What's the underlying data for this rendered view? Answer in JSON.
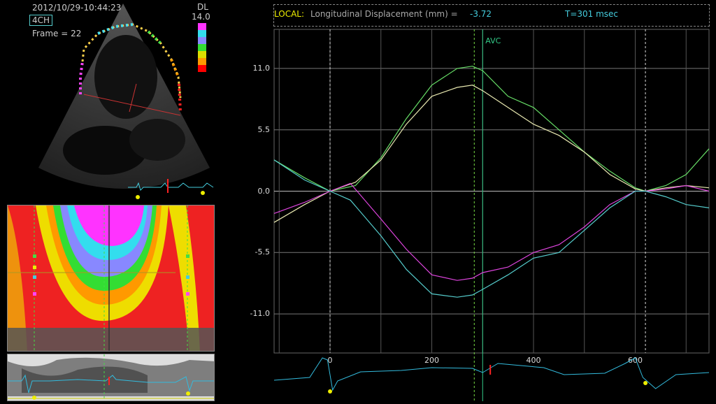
{
  "echo": {
    "timestamp": "2012/10/29-10:44:23",
    "view": "4CH",
    "frame": "Frame = 22",
    "scale_title": "DL",
    "scale_value": "14.0",
    "scale_colors": [
      "#ff33ff",
      "#33ddee",
      "#8888ff",
      "#33dd33",
      "#dddd00",
      "#ff9900",
      "#ff0000"
    ]
  },
  "header": {
    "local_label": "LOCAL:",
    "title": "Longitudinal Displacement (mm) =",
    "value": "-3.72",
    "time": "T=301 msec"
  },
  "graph": {
    "avc_label": "AVC",
    "ytick_labels": [
      "11.0",
      "5.5",
      "0.0",
      "-5.5",
      "-11.0"
    ],
    "xtick_labels": [
      "0",
      "200",
      "400",
      "600"
    ]
  },
  "chart_data": {
    "type": "line",
    "title": "Longitudinal Displacement (mm)",
    "xlabel": "msec",
    "ylabel": "",
    "xlim": [
      -110,
      745
    ],
    "ylim": [
      -14.5,
      14.5
    ],
    "yticks": [
      11.0,
      5.5,
      0.0,
      -5.5,
      -11.0
    ],
    "xticks": [
      0,
      200,
      400,
      600
    ],
    "vertical_markers": [
      {
        "label": "AVC",
        "x": 300
      },
      {
        "label": "",
        "x": 0
      },
      {
        "label": "",
        "x": 620
      }
    ],
    "series": [
      {
        "color": "#66dd66",
        "x": [
          -110,
          -50,
          0,
          50,
          100,
          150,
          200,
          250,
          280,
          300,
          350,
          400,
          450,
          500,
          550,
          600,
          620,
          660,
          700,
          745
        ],
        "y": [
          2.8,
          1.2,
          0.0,
          0.5,
          3.0,
          6.5,
          9.5,
          11.0,
          11.2,
          10.8,
          8.5,
          7.5,
          5.5,
          3.5,
          1.8,
          0.3,
          0.0,
          0.5,
          1.5,
          3.8
        ]
      },
      {
        "color": "#e8e8b0",
        "x": [
          -110,
          -50,
          0,
          50,
          100,
          150,
          200,
          250,
          280,
          300,
          350,
          400,
          450,
          500,
          550,
          600,
          620,
          660,
          700,
          745
        ],
        "y": [
          -2.8,
          -1.2,
          0.0,
          0.8,
          2.8,
          6.0,
          8.5,
          9.3,
          9.5,
          9.0,
          7.5,
          6.0,
          5.0,
          3.5,
          1.5,
          0.2,
          0.0,
          0.3,
          0.5,
          0.3
        ]
      },
      {
        "color": "#dd44dd",
        "x": [
          -110,
          -50,
          0,
          40,
          100,
          150,
          200,
          250,
          280,
          300,
          350,
          400,
          450,
          500,
          550,
          600,
          620,
          660,
          700,
          745
        ],
        "y": [
          -2.0,
          -1.0,
          0.0,
          0.7,
          -2.5,
          -5.2,
          -7.5,
          -8.0,
          -7.8,
          -7.3,
          -6.8,
          -5.5,
          -4.8,
          -3.2,
          -1.2,
          0.0,
          0.0,
          0.2,
          0.5,
          0.0
        ]
      },
      {
        "color": "#55cccc",
        "x": [
          -110,
          -50,
          0,
          40,
          100,
          150,
          200,
          250,
          280,
          300,
          350,
          400,
          450,
          500,
          550,
          600,
          620,
          660,
          700,
          745
        ],
        "y": [
          2.8,
          1.0,
          0.0,
          -0.8,
          -4.0,
          -7.0,
          -9.2,
          -9.5,
          -9.3,
          -8.8,
          -7.5,
          -6.0,
          -5.5,
          -3.5,
          -1.5,
          0.0,
          0.0,
          -0.5,
          -1.2,
          -1.5
        ]
      }
    ]
  }
}
